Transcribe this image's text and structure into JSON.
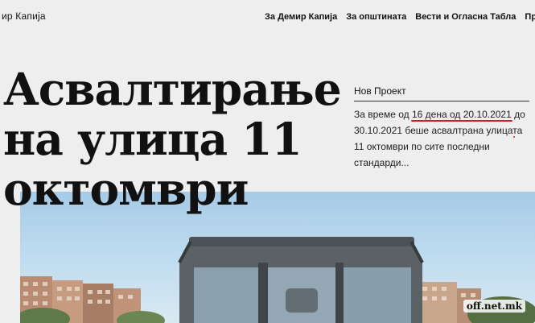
{
  "header": {
    "site_name": "ир Капија",
    "nav": [
      {
        "label": "За Демир Капија"
      },
      {
        "label": "За општината"
      },
      {
        "label": "Вести и Огласна Табла"
      },
      {
        "label": "Проекти"
      }
    ]
  },
  "article": {
    "title_lines": [
      "Асвалтирање",
      "на улица 11",
      "октомври"
    ],
    "project_label": "Нов Проект",
    "summary": {
      "p1": "За време од ",
      "mark1": "16 дена од 20.10.2021",
      "mark2": "до 30.10.2021",
      "p2": " беше асвалтрана улицата 11 октомври по сите последни стандарди..."
    }
  },
  "watermark": "off.net.mk",
  "colors": {
    "background": "#eeeeee",
    "underline": "#d21f26"
  }
}
